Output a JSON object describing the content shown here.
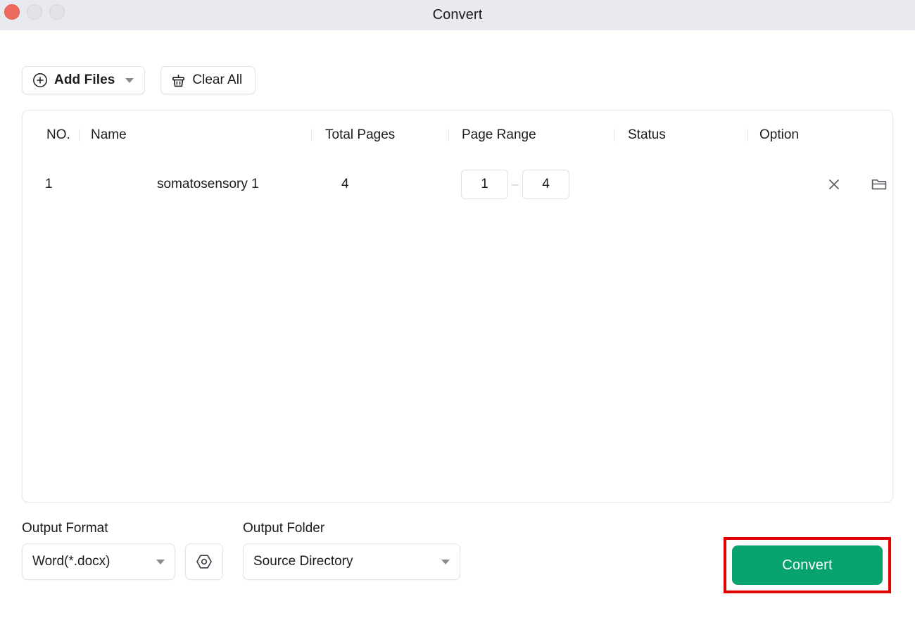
{
  "window": {
    "title": "Convert",
    "controls": [
      "close",
      "minimize",
      "zoom"
    ]
  },
  "toolbar": {
    "add_files_label": "Add Files",
    "add_files_icon": "plus-circle-icon",
    "add_files_caret_icon": "chevron-down-icon",
    "clear_all_label": "Clear All",
    "clear_all_icon": "broom-icon"
  },
  "table": {
    "columns": [
      {
        "key": "no",
        "label": "NO."
      },
      {
        "key": "name",
        "label": "Name"
      },
      {
        "key": "total_pages",
        "label": "Total Pages"
      },
      {
        "key": "page_range",
        "label": "Page Range"
      },
      {
        "key": "status",
        "label": "Status"
      },
      {
        "key": "option",
        "label": "Option"
      }
    ],
    "rows": [
      {
        "no": "1",
        "name": "somatosensory 1",
        "total_pages": "4",
        "page_range_from": "1",
        "page_range_to": "4",
        "page_range_separator": "–",
        "status": "",
        "option_remove_icon": "close-x-icon",
        "option_folder_icon": "folder-icon"
      }
    ]
  },
  "footer": {
    "output_format_label": "Output Format",
    "output_format_value": "Word(*.docx)",
    "output_format_caret_icon": "chevron-down-icon",
    "settings_icon": "hex-nut-settings-icon",
    "output_folder_label": "Output Folder",
    "output_folder_value": "Source Directory",
    "output_folder_caret_icon": "chevron-down-icon",
    "convert_label": "Convert"
  },
  "colors": {
    "titlebar_bg": "#e8eaf0",
    "close_dot": "#ec6a5e",
    "inactive_dot": "#e2e3e5",
    "convert_green": "#07a36c",
    "highlight_red": "#e00000",
    "panel_border": "#e7e7e9",
    "text": "#1c1c1e"
  }
}
